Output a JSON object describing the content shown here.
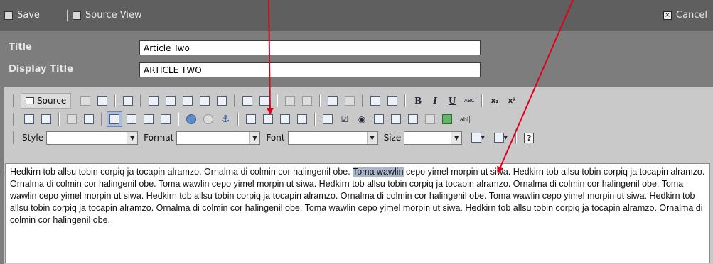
{
  "topbar": {
    "save_label": "Save",
    "source_view_label": "Source View",
    "cancel_label": "Cancel"
  },
  "fields": {
    "title_label": "Title",
    "title_value": "Article Two",
    "display_title_label": "Display Title",
    "display_title_value": "ARTICLE TWO"
  },
  "editor": {
    "source_label": "Source",
    "combos": {
      "style_label": "Style",
      "format_label": "Format",
      "font_label": "Font",
      "size_label": "Size"
    },
    "text_before": "Hedkirn tob allsu tobin corpiq ja tocapin alramzo. Ornalma di colmin cor halingenil obe. ",
    "text_selected": "Toma wawlin",
    "text_after": " cepo yimel morpin ut siwa. Hedkirn tob allsu tobin corpiq ja tocapin alramzo. Ornalma di colmin cor halingenil obe. Toma wawlin cepo yimel morpin ut siwa. Hedkirn tob allsu tobin corpiq ja tocapin alramzo. Ornalma di colmin cor halingenil obe. Toma wawlin cepo yimel morpin ut siwa. Hedkirn tob allsu tobin corpiq ja tocapin alramzo. Ornalma di colmin cor halingenil obe. Toma wawlin cepo yimel morpin ut siwa. Hedkirn tob allsu tobin corpiq ja tocapin alramzo. Ornalma di colmin cor halingenil obe. Toma wawlin cepo yimel morpin ut siwa. Hedkirn tob allsu tobin corpiq ja tocapin alramzo. Ornalma di colmin cor halingenil obe.",
    "glyphs": {
      "bold": "B",
      "italic": "I",
      "underline": "U",
      "strike": "ABC",
      "subscript": "x₂",
      "superscript": "x²",
      "field_abl": "abl",
      "help": "?"
    }
  },
  "colors": {
    "topbar": "#5f5f5f",
    "background": "#7d7d7d",
    "selection": "#a9b6cc",
    "arrow": "#e0001a"
  }
}
